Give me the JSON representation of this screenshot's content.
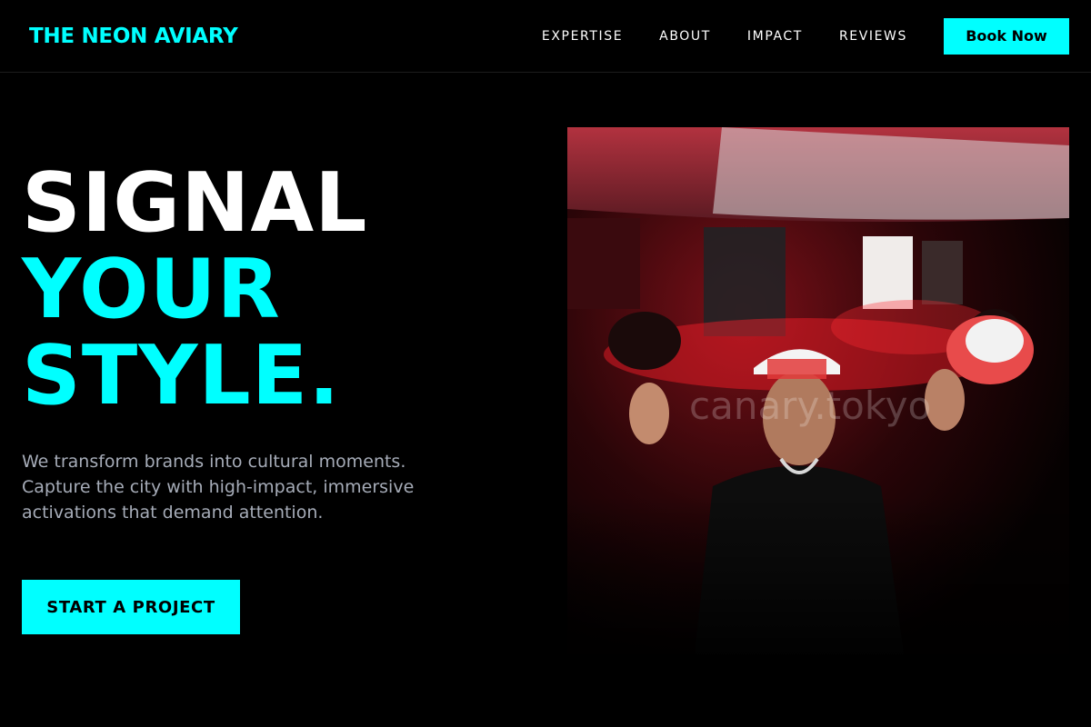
{
  "brand": {
    "name": "THE NEON AVIARY"
  },
  "nav": {
    "links": [
      "EXPERTISE",
      "ABOUT",
      "IMPACT",
      "REVIEWS"
    ],
    "cta_label": "Book Now"
  },
  "hero": {
    "headline_line1": "SIGNAL",
    "headline_line2": "YOUR",
    "headline_line3": "STYLE.",
    "subcopy": "We transform brands into cultural moments. Capture the city with high-impact, immersive activations that demand attention.",
    "cta_label": "START A PROJECT",
    "image_watermark": "canary.tokyo"
  },
  "colors": {
    "background": "#000000",
    "accent": "#00ffff",
    "text": "#ffffff",
    "muted_text": "#a6acb8"
  }
}
